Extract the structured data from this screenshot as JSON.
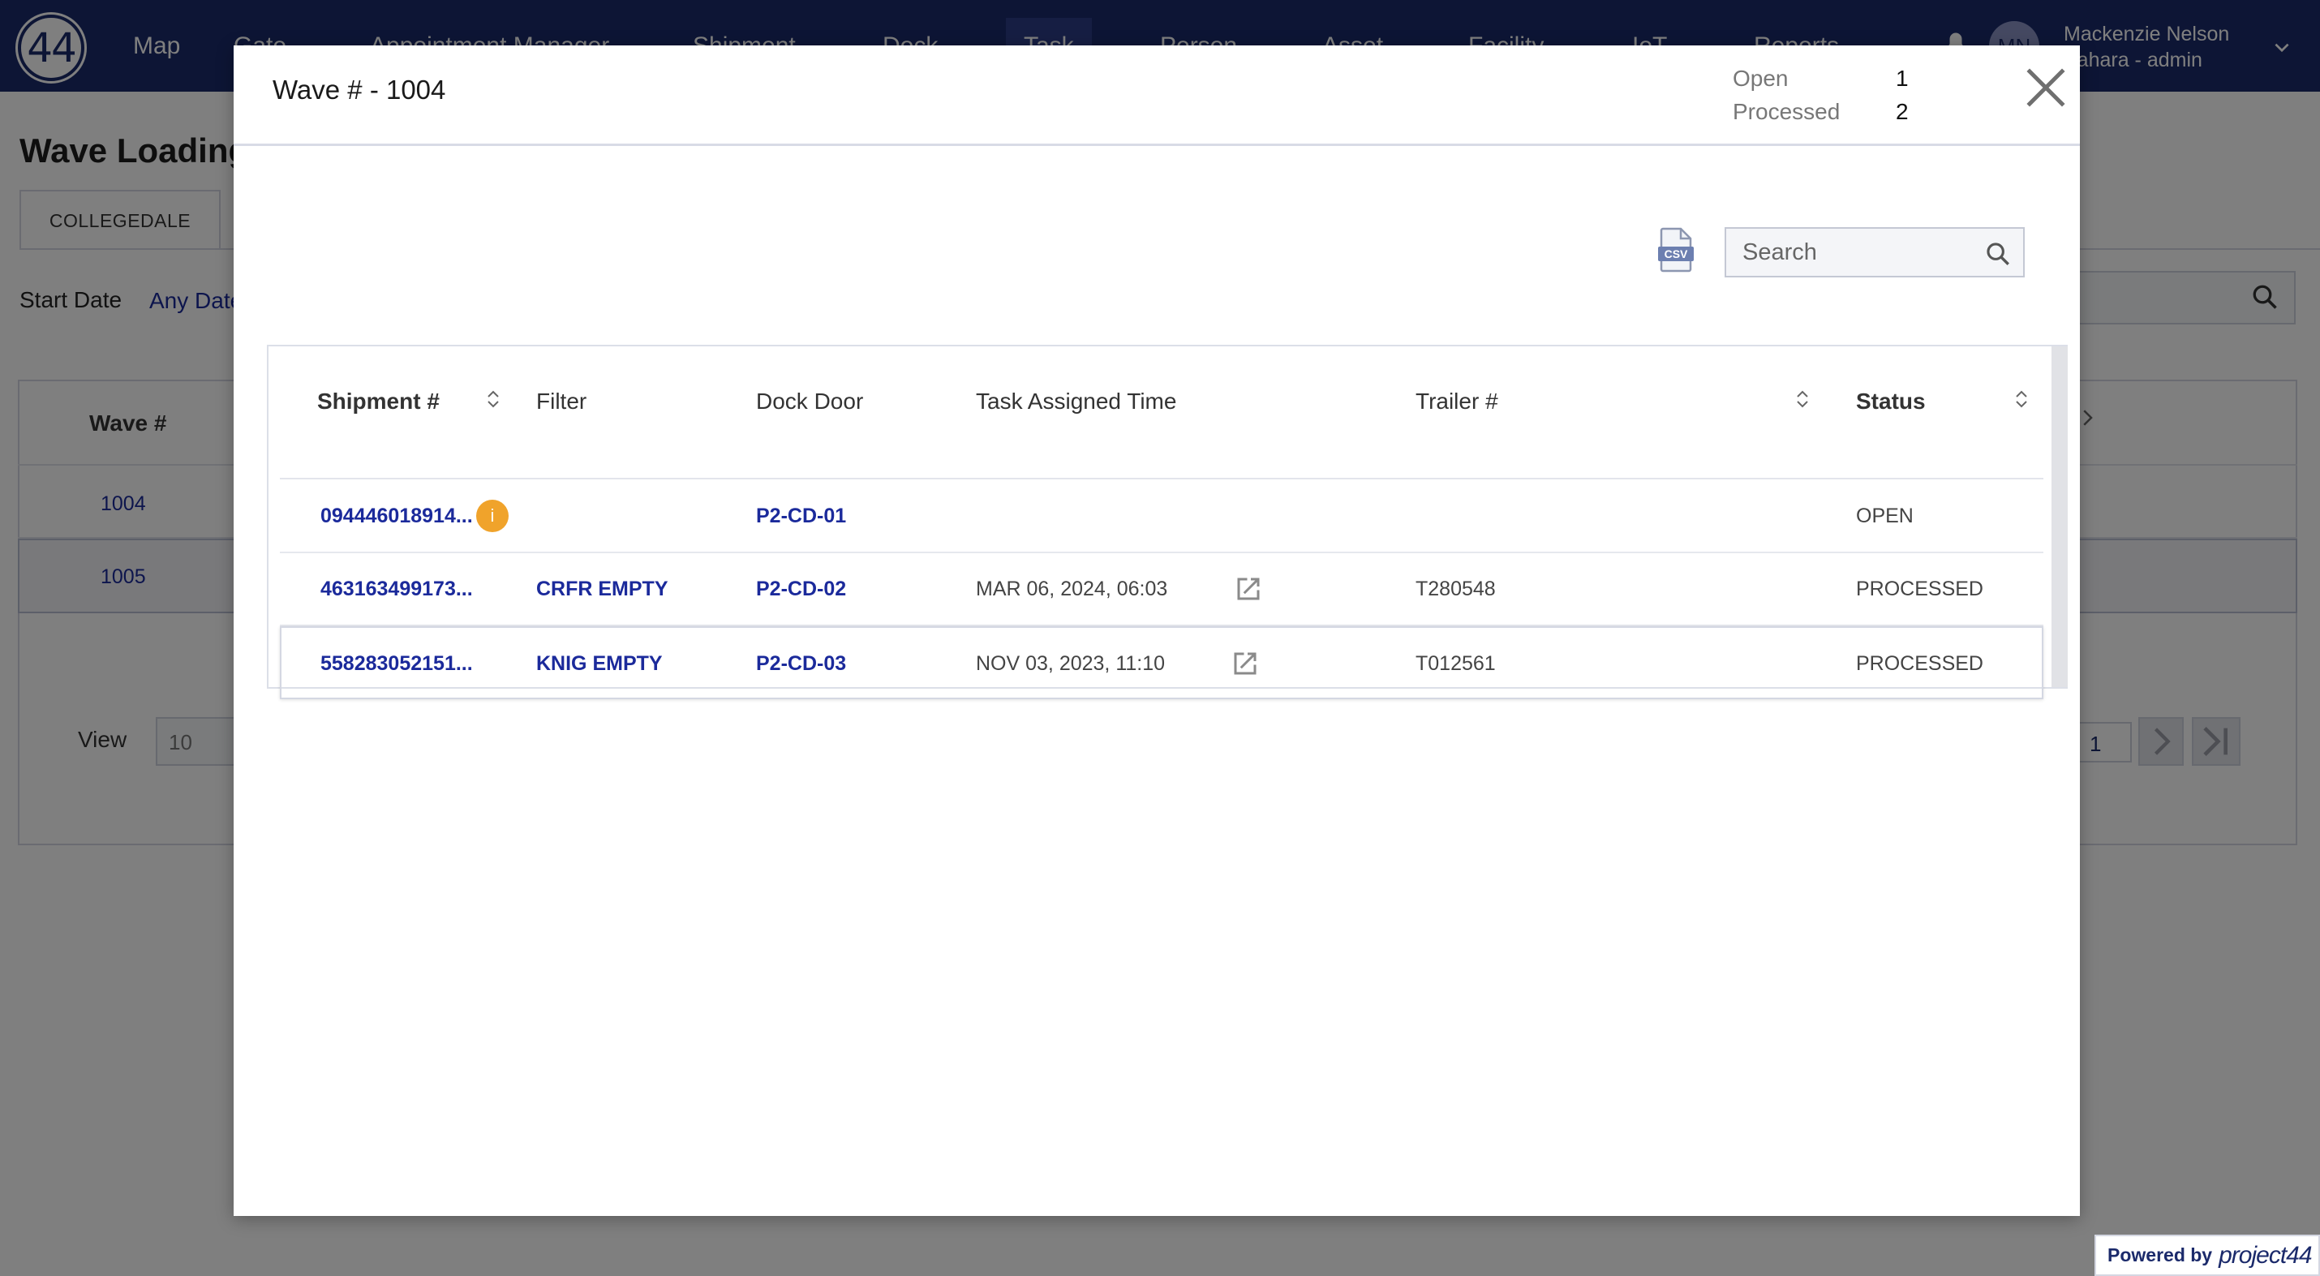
{
  "app": {
    "logo_text": "44",
    "nav": [
      {
        "label": "Map"
      },
      {
        "label": "Gate"
      },
      {
        "label": "Appointment Manager"
      },
      {
        "label": "Shipment"
      },
      {
        "label": "Dock"
      },
      {
        "label": "Task"
      },
      {
        "label": "Person"
      },
      {
        "label": "Asset"
      },
      {
        "label": "Facility"
      },
      {
        "label": "IoT"
      },
      {
        "label": "Reports"
      }
    ],
    "user": {
      "initials": "MN",
      "name": "Mackenzie Nelson",
      "role": "Sahara - admin"
    },
    "brand_color": "#1b2a6b"
  },
  "background": {
    "page_title": "Wave Loading",
    "tab_label": "COLLEGEDALE",
    "start_date_label": "Start Date",
    "start_date_value": "Any Date",
    "wave_header": "Wave #",
    "waves": [
      "1004",
      "1005"
    ],
    "view_label": "View",
    "view_value": "10",
    "page_number": "1",
    "powered_by_label": "Powered by",
    "powered_by_brand": "project44"
  },
  "modal": {
    "title": "Wave # - 1004",
    "stats": [
      {
        "label": "Open",
        "value": "1"
      },
      {
        "label": "Processed",
        "value": "2"
      }
    ],
    "search": {
      "placeholder": "Search",
      "value": ""
    },
    "csv_icon_text": "CSV",
    "columns": [
      "Shipment #",
      "Filter",
      "Dock Door",
      "Task Assigned Time",
      "Trailer #",
      "Status"
    ],
    "rows": [
      {
        "shipment": "094446018914...",
        "filter": "",
        "dock_door": "P2-CD-01",
        "task_time": "",
        "trailer": "",
        "status": "OPEN",
        "info_badge": "i"
      },
      {
        "shipment": "463163499173...",
        "filter": "CRFR EMPTY",
        "dock_door": "P2-CD-02",
        "task_time": "MAR 06, 2024, 06:03",
        "trailer": "T280548",
        "status": "PROCESSED"
      },
      {
        "shipment": "558283052151...",
        "filter": "KNIG EMPTY",
        "dock_door": "P2-CD-03",
        "task_time": "NOV 03, 2023, 11:10",
        "trailer": "T012561",
        "status": "PROCESSED"
      }
    ],
    "link_color": "#1b2a9b",
    "info_badge_color": "#f0a32b"
  }
}
